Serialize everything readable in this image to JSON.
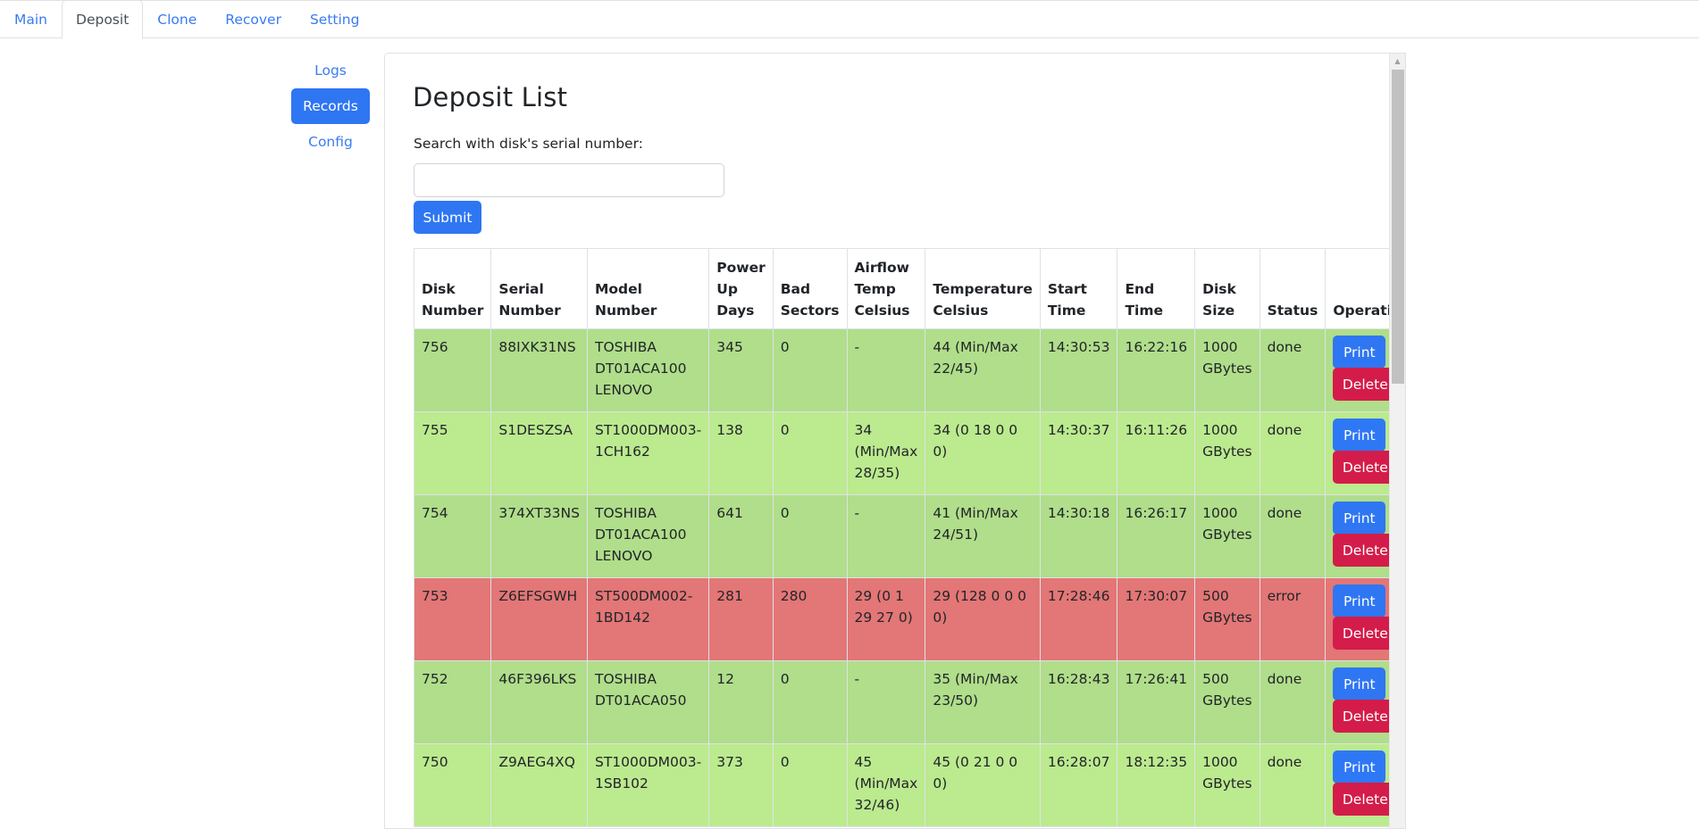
{
  "tabs": [
    {
      "label": "Main",
      "active": false
    },
    {
      "label": "Deposit",
      "active": true
    },
    {
      "label": "Clone",
      "active": false
    },
    {
      "label": "Recover",
      "active": false
    },
    {
      "label": "Setting",
      "active": false
    }
  ],
  "sidebar": {
    "items": [
      {
        "label": "Logs",
        "active": false
      },
      {
        "label": "Records",
        "active": true
      },
      {
        "label": "Config",
        "active": false
      }
    ]
  },
  "main": {
    "title": "Deposit List",
    "search": {
      "label": "Search with disk's serial number:",
      "value": "",
      "placeholder": ""
    },
    "submit_label": "Submit",
    "table": {
      "columns": [
        "Disk Number",
        "Serial Number",
        "Model Number",
        "Power Up Days",
        "Bad Sectors",
        "Airflow Temp Celsius",
        "Temperature Celsius",
        "Start Time",
        "End Time",
        "Disk Size",
        "Status",
        "Operation"
      ],
      "rows": [
        {
          "disk_number": "756",
          "serial_number": "88IXK31NS",
          "model_number": "TOSHIBA DT01ACA100 LENOVO",
          "power_up_days": "345",
          "bad_sectors": "0",
          "airflow_temp": "-",
          "temperature": "44 (Min/Max 22/45)",
          "start_time": "14:30:53",
          "end_time": "16:22:16",
          "disk_size": "1000 GBytes",
          "status": "done",
          "print_label": "Print",
          "delete_label": "Delete"
        },
        {
          "disk_number": "755",
          "serial_number": "S1DESZSA",
          "model_number": "ST1000DM003-1CH162",
          "power_up_days": "138",
          "bad_sectors": "0",
          "airflow_temp": "34 (Min/Max 28/35)",
          "temperature": "34 (0 18 0 0 0)",
          "start_time": "14:30:37",
          "end_time": "16:11:26",
          "disk_size": "1000 GBytes",
          "status": "done",
          "print_label": "Print",
          "delete_label": "Delete"
        },
        {
          "disk_number": "754",
          "serial_number": "374XT33NS",
          "model_number": "TOSHIBA DT01ACA100 LENOVO",
          "power_up_days": "641",
          "bad_sectors": "0",
          "airflow_temp": "-",
          "temperature": "41 (Min/Max 24/51)",
          "start_time": "14:30:18",
          "end_time": "16:26:17",
          "disk_size": "1000 GBytes",
          "status": "done",
          "print_label": "Print",
          "delete_label": "Delete"
        },
        {
          "disk_number": "753",
          "serial_number": "Z6EFSGWH",
          "model_number": "ST500DM002-1BD142",
          "power_up_days": "281",
          "bad_sectors": "280",
          "airflow_temp": "29 (0 1 29 27 0)",
          "temperature": "29 (128 0 0 0 0)",
          "start_time": "17:28:46",
          "end_time": "17:30:07",
          "disk_size": "500 GBytes",
          "status": "error",
          "print_label": "Print",
          "delete_label": "Delete"
        },
        {
          "disk_number": "752",
          "serial_number": "46F396LKS",
          "model_number": "TOSHIBA DT01ACA050",
          "power_up_days": "12",
          "bad_sectors": "0",
          "airflow_temp": "-",
          "temperature": "35 (Min/Max 23/50)",
          "start_time": "16:28:43",
          "end_time": "17:26:41",
          "disk_size": "500 GBytes",
          "status": "done",
          "print_label": "Print",
          "delete_label": "Delete"
        },
        {
          "disk_number": "750",
          "serial_number": "Z9AEG4XQ",
          "model_number": "ST1000DM003-1SB102",
          "power_up_days": "373",
          "bad_sectors": "0",
          "airflow_temp": "45 (Min/Max 32/46)",
          "temperature": "45 (0 21 0 0 0)",
          "start_time": "16:28:07",
          "end_time": "18:12:35",
          "disk_size": "1000 GBytes",
          "status": "done",
          "print_label": "Print",
          "delete_label": "Delete"
        }
      ]
    }
  },
  "colors": {
    "accent": "#2f76f3",
    "danger": "#d41c4a",
    "row_done_a": "#b0de8a",
    "row_done_b": "#bcea8f",
    "row_error": "#e37676"
  },
  "icons": {
    "scroll_up": "scroll-up-arrow-icon"
  }
}
